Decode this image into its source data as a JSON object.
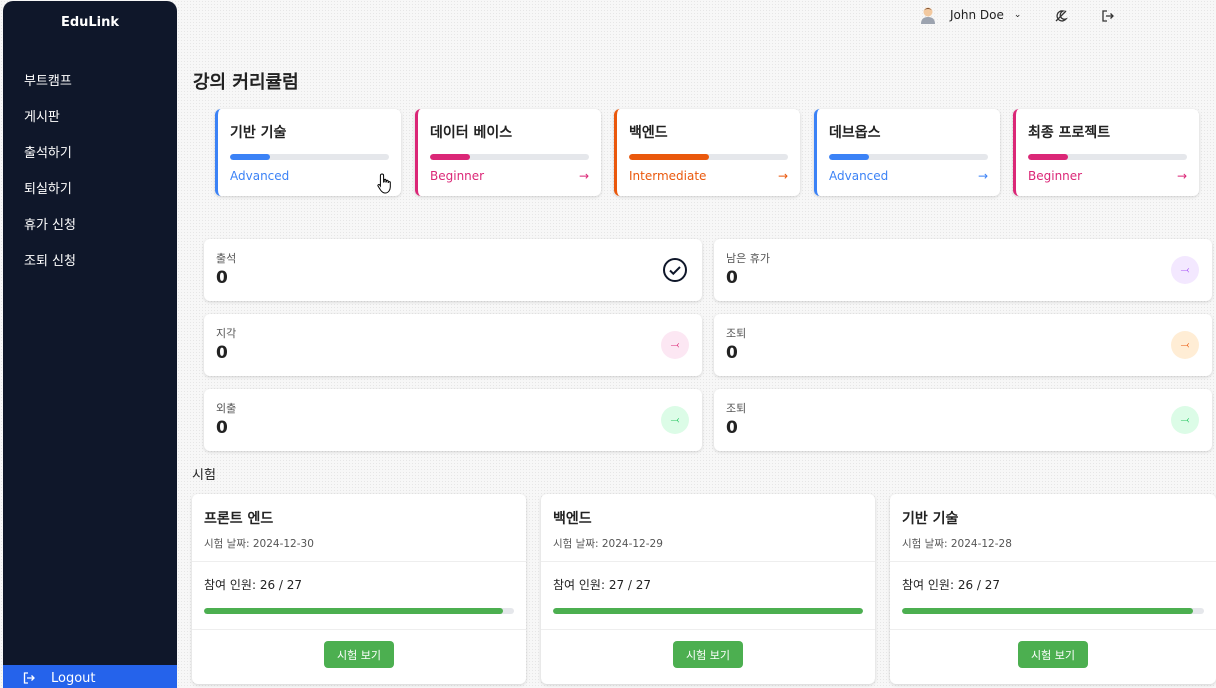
{
  "brand": "EduLink",
  "nav": [
    "부트캠프",
    "게시판",
    "출석하기",
    "퇴실하기",
    "휴가 신청",
    "조퇴 신청"
  ],
  "logout_label": "Logout",
  "user": {
    "name": "John Doe"
  },
  "page_title": "강의 커리큘럼",
  "courses": [
    {
      "name": "기반 기술",
      "level": "Advanced",
      "progress": 0.25,
      "color": "#3b82f6",
      "arrow": ""
    },
    {
      "name": "데이터 베이스",
      "level": "Beginner",
      "progress": 0.25,
      "color": "#db2777",
      "arrow": "→"
    },
    {
      "name": "백엔드",
      "level": "Intermediate",
      "progress": 0.5,
      "color": "#ea580c",
      "arrow": "→"
    },
    {
      "name": "데브옵스",
      "level": "Advanced",
      "progress": 0.25,
      "color": "#3b82f6",
      "arrow": "→"
    },
    {
      "name": "최종 프로젝트",
      "level": "Beginner",
      "progress": 0.25,
      "color": "#db2777",
      "arrow": "→"
    }
  ],
  "stats": [
    {
      "label": "출석",
      "value": "0",
      "icon": "check-circle-icon"
    },
    {
      "label": "남은 휴가",
      "value": "0",
      "icon": "leave-icon",
      "color": "#a855f7",
      "bg": "#f3e8ff"
    },
    {
      "label": "지각",
      "value": "0",
      "icon": "leave-icon",
      "color": "#db2777",
      "bg": "#fce7f3"
    },
    {
      "label": "조퇴",
      "value": "0",
      "icon": "leave-icon",
      "color": "#ea580c",
      "bg": "#ffedd5"
    },
    {
      "label": "외출",
      "value": "0",
      "icon": "leave-icon",
      "color": "#22c55e",
      "bg": "#dcfce7"
    },
    {
      "label": "조퇴",
      "value": "0",
      "icon": "leave-icon",
      "color": "#22c55e",
      "bg": "#dcfce7"
    }
  ],
  "exam_heading": "시험",
  "exams": [
    {
      "name": "프론트 엔드",
      "date": "시험 날짜: 2024-12-30",
      "participants": "참여 인원: 26 / 27",
      "ratio": 0.963,
      "button": "시험 보기"
    },
    {
      "name": "백엔드",
      "date": "시험 날짜: 2024-12-29",
      "participants": "참여 인원: 27 / 27",
      "ratio": 1.0,
      "button": "시험 보기"
    },
    {
      "name": "기반 기술",
      "date": "시험 날짜: 2024-12-28",
      "participants": "참여 인원: 26 / 27",
      "ratio": 0.963,
      "button": "시험 보기"
    }
  ]
}
